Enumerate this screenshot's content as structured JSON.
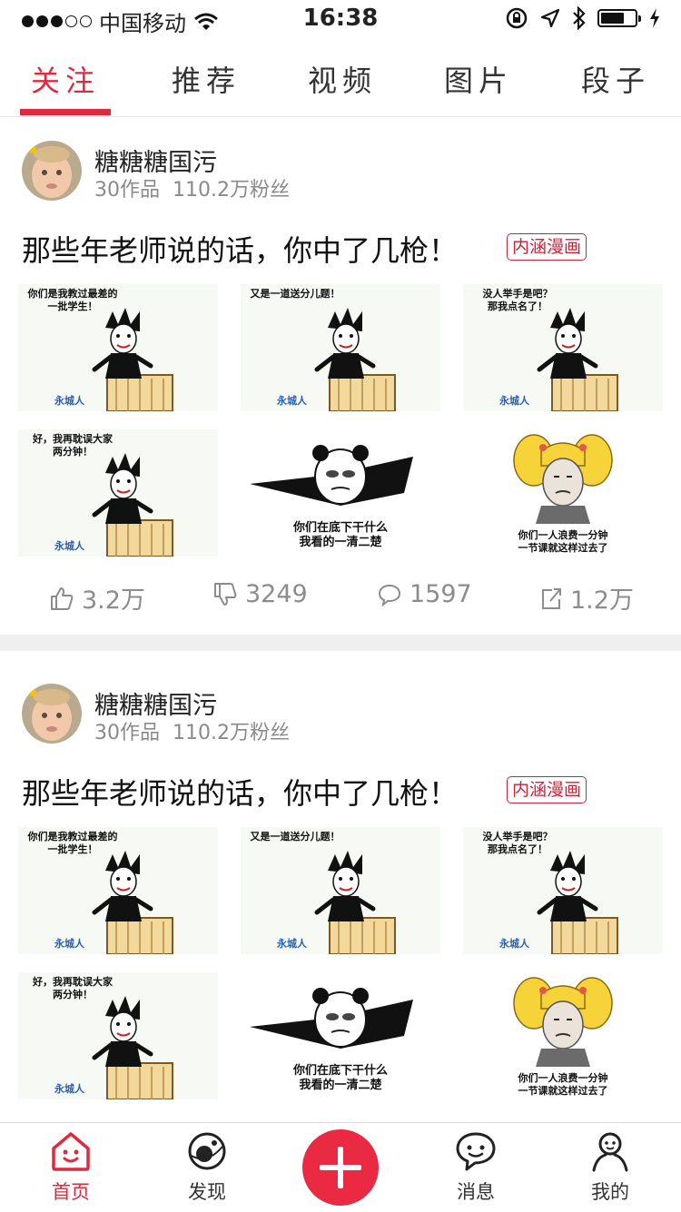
{
  "status_bar": {
    "carrier": "中国移动",
    "time": "16:38",
    "battery_level": 0.7
  },
  "tabs": [
    {
      "label": "关注",
      "active": true
    },
    {
      "label": "推荐",
      "active": false
    },
    {
      "label": "视频",
      "active": false
    },
    {
      "label": "图片",
      "active": false
    },
    {
      "label": "段子",
      "active": false
    }
  ],
  "posts": [
    {
      "author": "糖糖糖国污",
      "works": "30作品",
      "fans": "110.2万粉丝",
      "title": "那些年老师说的话，你中了几枪！",
      "tag": "内涵漫画",
      "images": [
        {
          "caption": "你们是我教过最差的\n一批学生！",
          "watermark": "永城人",
          "icon": "teacher-comic"
        },
        {
          "caption": "又是一道送分儿题！",
          "watermark": "永城人",
          "icon": "teacher-comic"
        },
        {
          "caption": "没人举手是吧？\n那我点名了！",
          "watermark": "永城人",
          "icon": "teacher-comic"
        },
        {
          "caption": "好，我再耽误大家\n两分钟！",
          "watermark": "永城人",
          "icon": "teacher-comic"
        },
        {
          "caption": "你们在底下干什么\n我看的一清二楚",
          "icon": "panda-meme"
        },
        {
          "caption": "你们一人浪费一分钟\n一节课就这样过去了",
          "icon": "pigtail-meme"
        }
      ],
      "likes": "3.2万",
      "dislikes": "3249",
      "comments": "1597",
      "shares": "1.2万"
    },
    {
      "author": "糖糖糖国污",
      "works": "30作品",
      "fans": "110.2万粉丝",
      "title": "那些年老师说的话，你中了几枪！",
      "tag": "内涵漫画",
      "images": [
        {
          "caption": "你们是我教过最差的\n一批学生！",
          "watermark": "永城人",
          "icon": "teacher-comic"
        },
        {
          "caption": "又是一道送分儿题！",
          "watermark": "永城人",
          "icon": "teacher-comic"
        },
        {
          "caption": "没人举手是吧？\n那我点名了！",
          "watermark": "永城人",
          "icon": "teacher-comic"
        },
        {
          "caption": "好，我再耽误大家\n两分钟！",
          "watermark": "永城人",
          "icon": "teacher-comic"
        },
        {
          "caption": "你们在底下干什么\n我看的一清二楚",
          "icon": "panda-meme"
        },
        {
          "caption": "你们一人浪费一分钟\n一节课就这样过去了",
          "icon": "pigtail-meme"
        }
      ]
    }
  ],
  "bottom_nav": [
    {
      "label": "首页",
      "icon": "home-icon",
      "active": true
    },
    {
      "label": "发现",
      "icon": "planet-icon",
      "active": false
    },
    {
      "label": "",
      "icon": "plus-icon",
      "active": false
    },
    {
      "label": "消息",
      "icon": "chat-icon",
      "active": false
    },
    {
      "label": "我的",
      "icon": "person-icon",
      "active": false
    }
  ],
  "colors": {
    "accent": "#e0283e",
    "publish_button": "#ea2a42",
    "tag_red": "#c8243a",
    "separator": "#efefef"
  }
}
